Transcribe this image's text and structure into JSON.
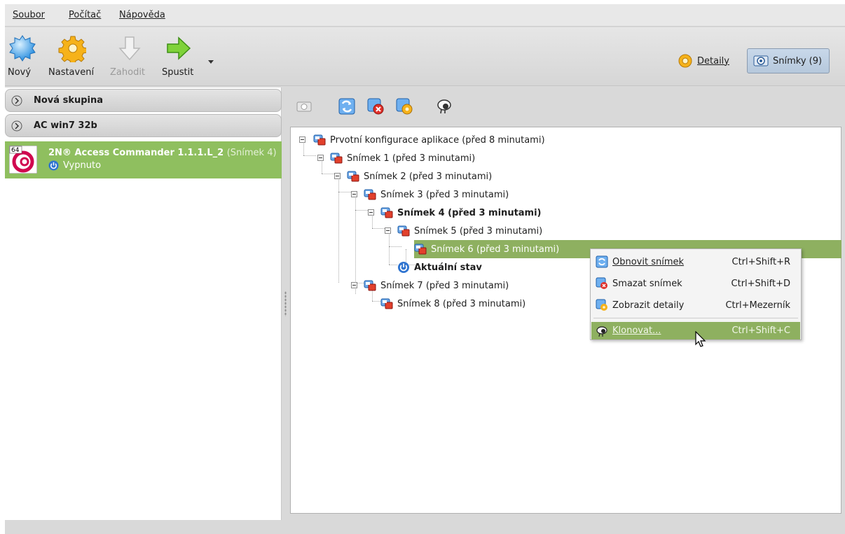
{
  "menubar": {
    "items": [
      {
        "label": "Soubor"
      },
      {
        "label": "Počítač"
      },
      {
        "label": "Nápověda"
      }
    ]
  },
  "toolbar": {
    "new_label": "Nový",
    "settings_label": "Nastavení",
    "discard_label": "Zahodit",
    "start_label": "Spustit",
    "details_label": "Detaily",
    "snapshots_label": "Snímky (9)"
  },
  "vm_list": {
    "groups": [
      {
        "label": "Nová skupina"
      },
      {
        "label": "AC win7 32b"
      }
    ],
    "selected_vm": {
      "name": "2N® Access Commander 1.1.1.L_2",
      "snapshot": "(Snímek 4)",
      "state": "Vypnuto",
      "arch_badge": "64"
    }
  },
  "snapshot_tree": {
    "items": [
      {
        "label": "Prvotní konfigurace aplikace (před 8 minutami)"
      },
      {
        "label": "Snímek 1 (před 3 minutami)"
      },
      {
        "label": "Snímek 2 (před 3 minutami)"
      },
      {
        "label": "Snímek 3 (před 3 minutami)"
      },
      {
        "label": "Snímek 4 (před 3 minutami)"
      },
      {
        "label": "Snímek 5 (před 3 minutami)"
      },
      {
        "label": "Snímek 6 (před 3 minutami)"
      },
      {
        "label": "Aktuální stav"
      },
      {
        "label": "Snímek 7 (před 3 minutami)"
      },
      {
        "label": "Snímek 8 (před 3 minutami)"
      }
    ]
  },
  "context_menu": {
    "items": [
      {
        "label": "Obnovit snímek",
        "shortcut": "Ctrl+Shift+R"
      },
      {
        "label": "Smazat snímek",
        "shortcut": "Ctrl+Shift+D"
      },
      {
        "label": "Zobrazit detaily",
        "shortcut": "Ctrl+Mezerník"
      },
      {
        "label": "Klonovat...",
        "shortcut": "Ctrl+Shift+C"
      }
    ]
  },
  "colors": {
    "selection_green": "#8eb060",
    "vm_row_green": "#8fbf5f",
    "window_gray": "#d9d9d9"
  },
  "icons": {
    "new": "new-vm-icon",
    "settings": "settings-gear-icon",
    "discard": "discard-arrow-icon",
    "start": "start-arrow-icon",
    "snapshot": "snapshot-icon",
    "restore": "restore-snapshot-icon",
    "delete": "delete-snapshot-icon",
    "details": "snapshot-details-icon",
    "clone": "clone-sheep-icon"
  }
}
